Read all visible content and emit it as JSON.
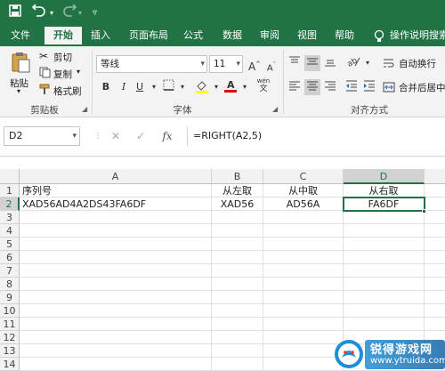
{
  "quick_access": {
    "save_icon": "save-icon",
    "undo_icon": "undo-icon",
    "redo_icon": "redo-icon",
    "customize_icon": "customize-qat-icon"
  },
  "tabs": [
    {
      "label": "文件"
    },
    {
      "label": "开始"
    },
    {
      "label": "插入"
    },
    {
      "label": "页面布局"
    },
    {
      "label": "公式"
    },
    {
      "label": "数据"
    },
    {
      "label": "审阅"
    },
    {
      "label": "视图"
    },
    {
      "label": "帮助"
    }
  ],
  "tell_me": "操作说明搜索",
  "ribbon": {
    "clipboard": {
      "paste": "粘贴",
      "cut": "剪切",
      "copy": "复制",
      "format_painter": "格式刷",
      "group_label": "剪贴板"
    },
    "font": {
      "font_name": "等线",
      "font_size": "11",
      "grow": "A",
      "shrink": "A",
      "bold": "B",
      "italic": "I",
      "underline": "U",
      "group_label": "字体",
      "phonetic": "wén"
    },
    "alignment": {
      "wrap_text": "自动换行",
      "merge_center": "合并后居中",
      "group_label": "对齐方式"
    }
  },
  "formula_bar": {
    "name_box": "D2",
    "cancel": "✕",
    "enter": "✓",
    "fx": "fx",
    "formula": "=RIGHT(A2,5)"
  },
  "grid": {
    "columns": [
      "A",
      "B",
      "C",
      "D"
    ],
    "selected_column": "D",
    "rows": [
      "1",
      "2",
      "3",
      "4",
      "5",
      "6",
      "7",
      "8",
      "9",
      "10",
      "11",
      "12",
      "13",
      "14"
    ],
    "selected_row": "2",
    "cells": {
      "A1": "序列号",
      "B1": "从左取",
      "C1": "从中取",
      "D1": "从右取",
      "A2": "XAD56AD4A2DS43FA6DF",
      "B2": "XAD56",
      "C2": "AD56A",
      "D2": "FA6DF"
    }
  },
  "watermark": {
    "title": "锐得游戏网",
    "url": "www.ytruida.com"
  },
  "colors": {
    "excel_green": "#217346"
  }
}
